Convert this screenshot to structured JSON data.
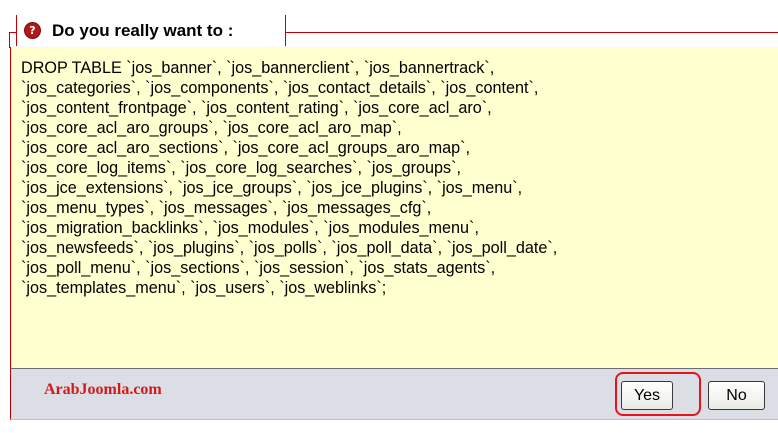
{
  "dialog": {
    "title": "Do you really want to :",
    "title_icon": "alert-icon",
    "message_lines": [
      "DROP TABLE `jos_banner`, `jos_bannerclient`, `jos_bannertrack`,",
      "`jos_categories`, `jos_components`, `jos_contact_details`, `jos_content`,",
      "`jos_content_frontpage`, `jos_content_rating`, `jos_core_acl_aro`,",
      "`jos_core_acl_aro_groups`, `jos_core_acl_aro_map`,",
      "`jos_core_acl_aro_sections`, `jos_core_acl_groups_aro_map`,",
      "`jos_core_log_items`, `jos_core_log_searches`, `jos_groups`,",
      "`jos_jce_extensions`, `jos_jce_groups`, `jos_jce_plugins`, `jos_menu`,",
      "`jos_menu_types`, `jos_messages`, `jos_messages_cfg`,",
      "`jos_migration_backlinks`, `jos_modules`, `jos_modules_menu`,",
      "`jos_newsfeeds`, `jos_plugins`, `jos_polls`, `jos_poll_data`, `jos_poll_date`,",
      "`jos_poll_menu`, `jos_sections`, `jos_session`, `jos_stats_agents`,",
      "`jos_templates_menu`, `jos_users`, `jos_weblinks`;"
    ]
  },
  "footer": {
    "brand": "ArabJoomla.com",
    "yes_label": "Yes",
    "no_label": "No"
  },
  "colors": {
    "frame": "#c00000",
    "body_bg": "#ffffd0",
    "footer_bg": "#dcdee5",
    "brand": "#d21a1a",
    "highlight": "#e4151b"
  }
}
